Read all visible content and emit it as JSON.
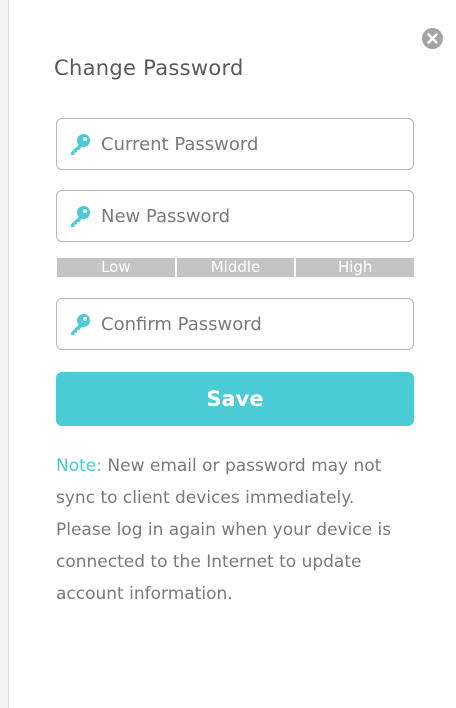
{
  "dialog": {
    "title": "Change Password",
    "close_icon": "close-circle-icon"
  },
  "fields": {
    "current_password": {
      "placeholder": "Current Password",
      "value": "",
      "icon": "key-icon"
    },
    "new_password": {
      "placeholder": "New Password",
      "value": "",
      "icon": "key-icon"
    },
    "confirm_password": {
      "placeholder": "Confirm Password",
      "value": "",
      "icon": "key-icon"
    }
  },
  "strength_meter": {
    "levels": [
      "Low",
      "Middle",
      "High"
    ]
  },
  "save_button": {
    "label": "Save"
  },
  "note": {
    "label": "Note:",
    "text": " New email or password may not sync to client devices immediately. Please log in again when your device is connected to the Internet to update account information."
  },
  "colors": {
    "accent": "#4acbd6",
    "strength_bar": "#c4c4c4",
    "close_button": "#a3a3a3"
  }
}
